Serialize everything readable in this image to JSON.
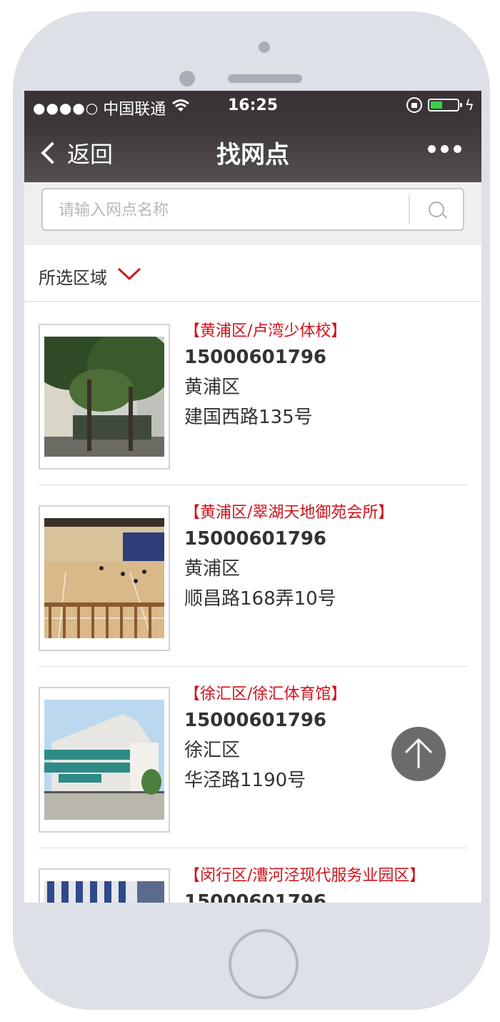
{
  "status_bar": {
    "signal_dots": "●●●●○",
    "carrier": "中国联通",
    "time": "16:25",
    "battery_color": "#39d24a",
    "battery_level": 0.45
  },
  "nav": {
    "back_label": "返回",
    "title": "找网点"
  },
  "search": {
    "placeholder": "请输入网点名称"
  },
  "filter": {
    "label": "所选区域"
  },
  "outlets": [
    {
      "title": "【黄浦区/卢湾少体校】",
      "phone": "15000601796",
      "district": "黄浦区",
      "address": "建国西路135号",
      "image": "street-trees-photo"
    },
    {
      "title": "【黄浦区/翠湖天地御苑会所】",
      "phone": "15000601796",
      "district": "黄浦区",
      "address": "顺昌路168弄10号",
      "image": "indoor-court-photo"
    },
    {
      "title": "【徐汇区/徐汇体育馆】",
      "phone": "15000601796",
      "district": "徐汇区",
      "address": "华泾路1190号",
      "image": "gymnasium-building-photo"
    },
    {
      "title": "【闵行区/漕河泾现代服务业园区】",
      "phone": "15000601796",
      "district": "",
      "address": "",
      "image": "office-building-photo"
    }
  ],
  "colors": {
    "accent": "#d0121b",
    "nav_bg": "#3c3638"
  },
  "icons": [
    "back-chevron-icon",
    "more-icon",
    "search-icon",
    "chevron-down-icon",
    "scroll-top-arrow-icon",
    "wifi-icon",
    "rotation-lock-icon",
    "battery-icon",
    "charging-bolt-icon"
  ]
}
